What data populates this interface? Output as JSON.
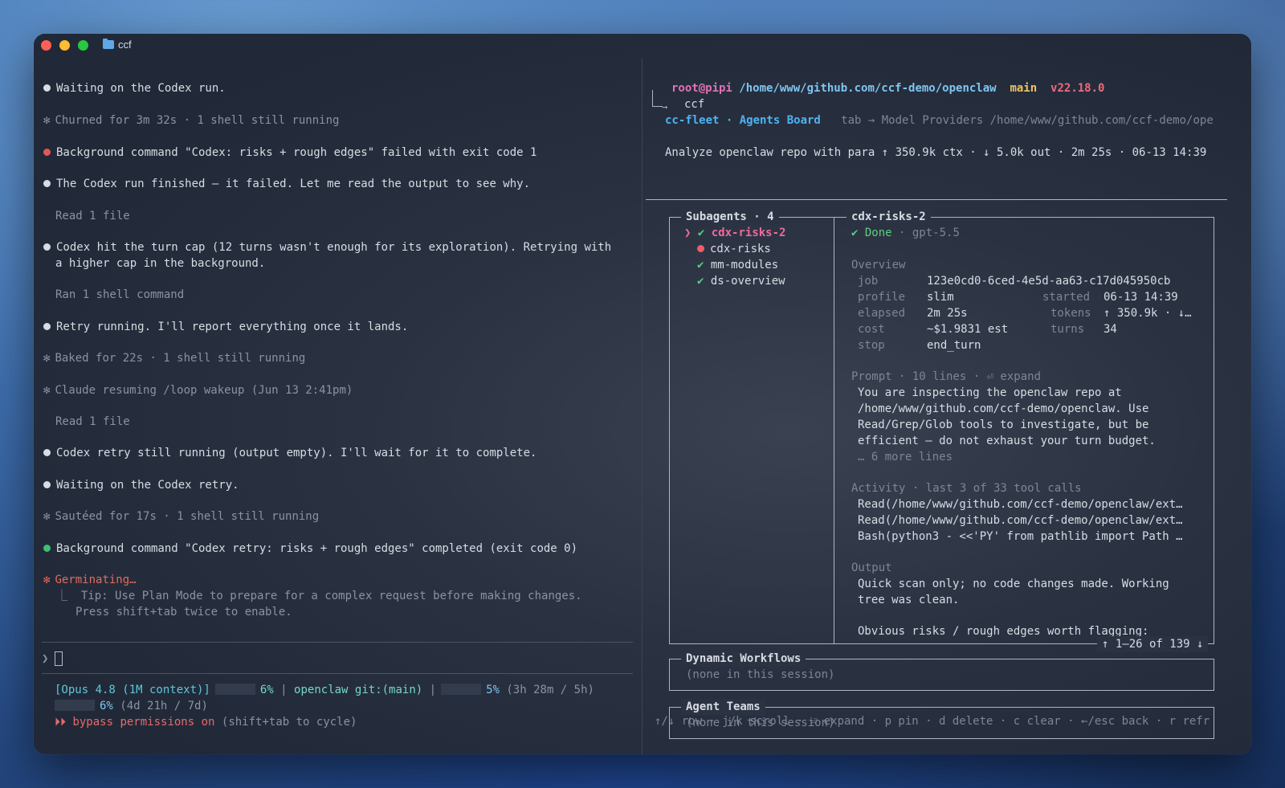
{
  "window": {
    "title": "ccf"
  },
  "left": {
    "lines": [
      {
        "kind": "bullet",
        "text": "Waiting on the Codex run."
      },
      {
        "kind": "star",
        "text": "Churned for 3m 32s · 1 shell still running"
      },
      {
        "kind": "bullet-red",
        "text": "Background command \"Codex: risks + rough edges\" failed with exit code 1"
      },
      {
        "kind": "bullet",
        "text": "The Codex run finished — it failed. Let me read the output to see why."
      },
      {
        "kind": "indent",
        "text": "Read 1 file"
      },
      {
        "kind": "bullet",
        "text": "Codex hit the turn cap (12 turns wasn't enough for its exploration). Retrying with"
      },
      {
        "kind": "cont",
        "text": "a higher cap in the background."
      },
      {
        "kind": "indent",
        "text": "Ran 1 shell command"
      },
      {
        "kind": "bullet",
        "text": "Retry running. I'll report everything once it lands."
      },
      {
        "kind": "star",
        "text": "Baked for 22s · 1 shell still running"
      },
      {
        "kind": "star",
        "text": "Claude resuming /loop wakeup (Jun 13 2:41pm)"
      },
      {
        "kind": "indent",
        "text": "Read 1 file"
      },
      {
        "kind": "bullet",
        "text": "Codex retry still running (output empty). I'll wait for it to complete."
      },
      {
        "kind": "bullet",
        "text": "Waiting on the Codex retry."
      },
      {
        "kind": "star",
        "text": "Sautéed for 17s · 1 shell still running"
      },
      {
        "kind": "bullet-green",
        "text": "Background command \"Codex retry: risks + rough edges\" completed (exit code 0)"
      }
    ],
    "germinating": "Germinating…",
    "tip1": "⎿  Tip: Use Plan Mode to prepare for a complex request before making changes.",
    "tip2": "Press shift+tab twice to enable.",
    "prompt_char": "❯",
    "status": {
      "model": "[Opus 4.8 (1M context)]",
      "ctx_pct": "6%",
      "repo": "openclaw git:(main)",
      "sep": "|",
      "sess_pct": "5%",
      "sess_time": "(3h 28m / 5h)",
      "week_pct": "6%",
      "week_time": "(4d 21h / 7d)",
      "perm_arrows": "⏵⏵",
      "perm_text": "bypass permissions on",
      "perm_hint": "(shift+tab to cycle)"
    }
  },
  "right": {
    "prompt": {
      "user": "root@pipi",
      "path": "/home/www/github.com/ccf-demo/openclaw",
      "branch": "main",
      "version": "v22.18.0",
      "command": "ccf"
    },
    "board": {
      "app": "cc-fleet · Agents Board",
      "tab_hint": "tab → Model Providers /home/www/github.com/ccf-demo/ope"
    },
    "summary": "Analyze openclaw repo with para ↑ 350.9k ctx · ↓ 5.0k out · 2m 25s · 06-13 14:39",
    "subagents": {
      "title": "Subagents · 4",
      "items": [
        {
          "name": "cdx-risks-2",
          "status": "done",
          "selected": true
        },
        {
          "name": "cdx-risks",
          "status": "failed",
          "selected": false
        },
        {
          "name": "mm-modules",
          "status": "done",
          "selected": false
        },
        {
          "name": "ds-overview",
          "status": "done",
          "selected": false
        }
      ]
    },
    "detail": {
      "title": "cdx-risks-2",
      "status": "✔ Done",
      "model": "· gpt-5.5",
      "overview_label": "Overview",
      "job_k": "job",
      "job_v": "123e0cd0-6ced-4e5d-aa63-c17d045950cb",
      "profile_k": "profile",
      "profile_v": "slim",
      "started_k": "started",
      "started_v": "06-13 14:39",
      "elapsed_k": "elapsed",
      "elapsed_v": "2m 25s",
      "tokens_k": "tokens",
      "tokens_v": "↑ 350.9k · ↓…",
      "cost_k": "cost",
      "cost_v": "~$1.9831 est",
      "turns_k": "turns",
      "turns_v": "34",
      "stop_k": "stop",
      "stop_v": "end_turn",
      "prompt_label": "Prompt · 10 lines · ⏎ expand",
      "prompt_lines": [
        "You are inspecting the openclaw repo at",
        "/home/www/github.com/ccf-demo/openclaw. Use",
        "Read/Grep/Glob tools to investigate, but be",
        "efficient — do not exhaust your turn budget."
      ],
      "prompt_more": "… 6 more lines",
      "activity_label": "Activity · last 3 of 33 tool calls",
      "activity": [
        "Read(/home/www/github.com/ccf-demo/openclaw/ext…",
        "Read(/home/www/github.com/ccf-demo/openclaw/ext…",
        "Bash(python3 - <<'PY' from pathlib import Path …"
      ],
      "output_label": "Output",
      "output_lines": [
        "Quick scan only; no code changes made. Working",
        "tree was clean.",
        "",
        "Obvious risks / rough edges worth flagging:"
      ],
      "scroll": "↑ 1–26 of 139 ↓"
    },
    "workflows": {
      "title": "Dynamic Workflows",
      "empty": "(none in this session)"
    },
    "teams": {
      "title": "Agent Teams",
      "empty": "(none in this session)"
    },
    "footer": "↑/↓ row · j/k scroll · ⏎ expand · p pin · d delete · c clear · ←/esc back · r refr"
  }
}
